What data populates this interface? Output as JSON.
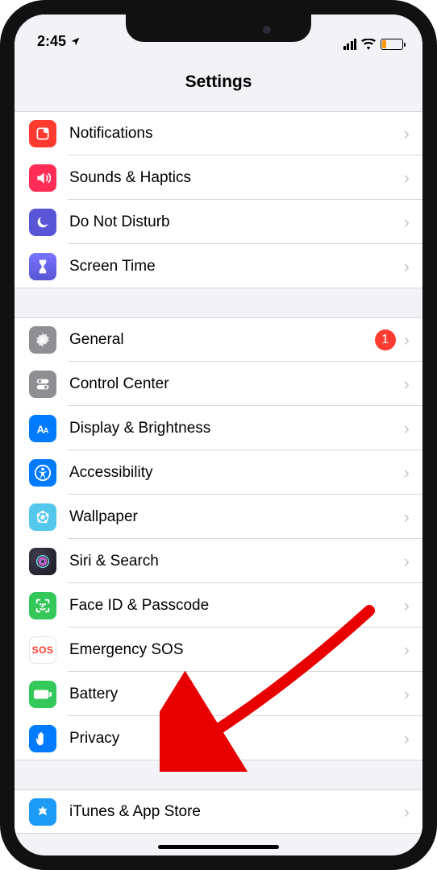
{
  "status": {
    "time": "2:45",
    "location_icon": "location-arrow"
  },
  "header": {
    "title": "Settings"
  },
  "groups": [
    {
      "rows": [
        {
          "id": "notifications",
          "label": "Notifications",
          "icon": "notifications-icon",
          "bg": "#ff3b30"
        },
        {
          "id": "sounds",
          "label": "Sounds & Haptics",
          "icon": "speaker-icon",
          "bg": "#ff2d55"
        },
        {
          "id": "dnd",
          "label": "Do Not Disturb",
          "icon": "moon-icon",
          "bg": "#5856d6"
        },
        {
          "id": "screentime",
          "label": "Screen Time",
          "icon": "hourglass-icon",
          "bg": "linear-gradient(#7a74ff,#5856d6)"
        }
      ]
    },
    {
      "rows": [
        {
          "id": "general",
          "label": "General",
          "icon": "gear-icon",
          "bg": "#8e8e93",
          "badge": "1"
        },
        {
          "id": "control-center",
          "label": "Control Center",
          "icon": "toggles-icon",
          "bg": "#8e8e93"
        },
        {
          "id": "display",
          "label": "Display & Brightness",
          "icon": "text-size-icon",
          "bg": "#007aff"
        },
        {
          "id": "accessibility",
          "label": "Accessibility",
          "icon": "accessibility-icon",
          "bg": "#007aff"
        },
        {
          "id": "wallpaper",
          "label": "Wallpaper",
          "icon": "wallpaper-icon",
          "bg": "#54c7ec"
        },
        {
          "id": "siri",
          "label": "Siri & Search",
          "icon": "siri-icon",
          "bg": "radial-gradient(circle at 30% 30%,#3c3c4c,#1b1b26)"
        },
        {
          "id": "faceid",
          "label": "Face ID & Passcode",
          "icon": "face-id-icon",
          "bg": "#34c759"
        },
        {
          "id": "sos",
          "label": "Emergency SOS",
          "icon": "sos-icon",
          "bg": "#ffffff"
        },
        {
          "id": "battery",
          "label": "Battery",
          "icon": "battery-icon",
          "bg": "#34c759"
        },
        {
          "id": "privacy",
          "label": "Privacy",
          "icon": "hand-icon",
          "bg": "#007aff"
        }
      ]
    },
    {
      "rows": [
        {
          "id": "itunes",
          "label": "iTunes & App Store",
          "icon": "appstore-icon",
          "bg": "#1c9cf6"
        }
      ]
    }
  ],
  "annotation": {
    "arrow_target": "privacy"
  }
}
